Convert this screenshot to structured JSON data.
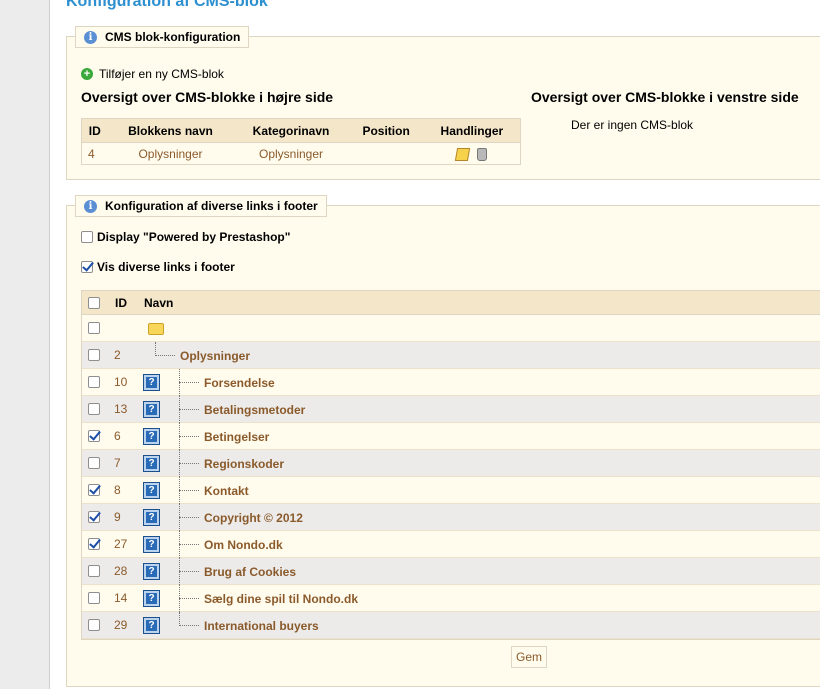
{
  "page": {
    "title": "Konfiguration af CMS-blok"
  },
  "cms_section": {
    "legend": "CMS blok-konfiguration",
    "add_label": "Tilføjer en ny CMS-blok",
    "right_heading": "Oversigt over CMS-blokke i højre side",
    "left_heading": "Oversigt over CMS-blokke i venstre side",
    "left_empty": "Der er ingen CMS-blok",
    "table": {
      "headers": [
        "ID",
        "Blokkens navn",
        "Kategorinavn",
        "Position",
        "Handlinger"
      ],
      "rows": [
        {
          "id": "4",
          "name": "Oplysninger",
          "category": "Oplysninger",
          "position": ""
        }
      ]
    }
  },
  "footer_section": {
    "legend": "Konfiguration af diverse links i footer",
    "powered_label": "Display \"Powered by Prestashop\"",
    "powered_checked": false,
    "show_links_label": "Vis diverse links i footer",
    "show_links_checked": true,
    "tree_headers": {
      "id": "ID",
      "name": "Navn"
    },
    "category": {
      "id": "2",
      "name": "Oplysninger"
    },
    "pages": [
      {
        "id": "10",
        "name": "Forsendelse",
        "checked": false
      },
      {
        "id": "13",
        "name": "Betalingsmetoder",
        "checked": false
      },
      {
        "id": "6",
        "name": "Betingelser",
        "checked": true
      },
      {
        "id": "7",
        "name": "Regionskoder",
        "checked": false
      },
      {
        "id": "8",
        "name": "Kontakt",
        "checked": true
      },
      {
        "id": "9",
        "name": "Copyright © 2012",
        "checked": true
      },
      {
        "id": "27",
        "name": "Om Nondo.dk",
        "checked": true
      },
      {
        "id": "28",
        "name": "Brug af Cookies",
        "checked": false
      },
      {
        "id": "14",
        "name": "Sælg dine spil til Nondo.dk",
        "checked": false
      },
      {
        "id": "29",
        "name": "International buyers",
        "checked": false
      }
    ],
    "save_label": "Gem"
  }
}
